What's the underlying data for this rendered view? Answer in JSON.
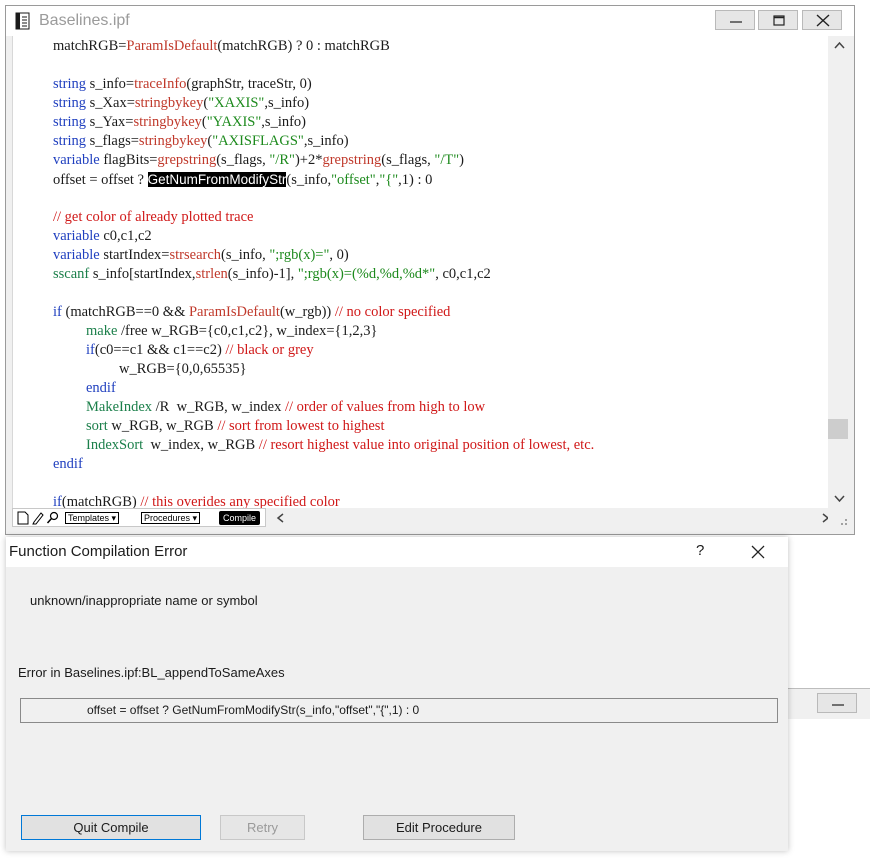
{
  "window": {
    "title": "Baselines.ipf",
    "icons": {
      "doc": "procedure-doc-icon",
      "minimize": "minimize-icon",
      "maximize": "maximize-icon",
      "close": "close-icon"
    }
  },
  "code": {
    "lines": [
      [
        {
          "t": "matchRGB=",
          "c": ""
        },
        {
          "t": "ParamIsDefault",
          "c": "fn"
        },
        {
          "t": "(matchRGB) ? 0 : matchRGB",
          "c": ""
        }
      ],
      [],
      [
        {
          "t": "string",
          "c": "kw"
        },
        {
          "t": " s_info=",
          "c": ""
        },
        {
          "t": "traceInfo",
          "c": "fn"
        },
        {
          "t": "(graphStr, traceStr, 0)",
          "c": ""
        }
      ],
      [
        {
          "t": "string",
          "c": "kw"
        },
        {
          "t": " s_Xax=",
          "c": ""
        },
        {
          "t": "stringbykey",
          "c": "fn"
        },
        {
          "t": "(",
          "c": ""
        },
        {
          "t": "\"XAXIS\"",
          "c": "str"
        },
        {
          "t": ",s_info)",
          "c": ""
        }
      ],
      [
        {
          "t": "string",
          "c": "kw"
        },
        {
          "t": " s_Yax=",
          "c": ""
        },
        {
          "t": "stringbykey",
          "c": "fn"
        },
        {
          "t": "(",
          "c": ""
        },
        {
          "t": "\"YAXIS\"",
          "c": "str"
        },
        {
          "t": ",s_info)",
          "c": ""
        }
      ],
      [
        {
          "t": "string",
          "c": "kw"
        },
        {
          "t": " s_flags=",
          "c": ""
        },
        {
          "t": "stringbykey",
          "c": "fn"
        },
        {
          "t": "(",
          "c": ""
        },
        {
          "t": "\"AXISFLAGS\"",
          "c": "str"
        },
        {
          "t": ",s_info)",
          "c": ""
        }
      ],
      [
        {
          "t": "variable",
          "c": "kw"
        },
        {
          "t": " flagBits=",
          "c": ""
        },
        {
          "t": "grepstring",
          "c": "fn"
        },
        {
          "t": "(s_flags, ",
          "c": ""
        },
        {
          "t": "\"/R\"",
          "c": "str"
        },
        {
          "t": ")+2*",
          "c": ""
        },
        {
          "t": "grepstring",
          "c": "fn"
        },
        {
          "t": "(s_flags, ",
          "c": ""
        },
        {
          "t": "\"/T\"",
          "c": "str"
        },
        {
          "t": ")",
          "c": ""
        }
      ],
      [
        {
          "t": "offset = offset ? ",
          "c": ""
        },
        {
          "t": "GetNumFromModifyStr",
          "c": "sel"
        },
        {
          "t": "(s_info,",
          "c": ""
        },
        {
          "t": "\"offset\"",
          "c": "str"
        },
        {
          "t": ",",
          "c": ""
        },
        {
          "t": "\"{\"",
          "c": "str"
        },
        {
          "t": ",1) : 0",
          "c": ""
        }
      ],
      [],
      [
        {
          "t": "// get color of already plotted trace",
          "c": "cm"
        }
      ],
      [
        {
          "t": "variable",
          "c": "kw"
        },
        {
          "t": " c0,c1,c2",
          "c": ""
        }
      ],
      [
        {
          "t": "variable",
          "c": "kw"
        },
        {
          "t": " startIndex=",
          "c": ""
        },
        {
          "t": "strsearch",
          "c": "fn"
        },
        {
          "t": "(s_info, ",
          "c": ""
        },
        {
          "t": "\";rgb(x)=\"",
          "c": "str"
        },
        {
          "t": ", 0)",
          "c": ""
        }
      ],
      [
        {
          "t": "sscanf",
          "c": "op"
        },
        {
          "t": " s_info[startIndex,",
          "c": ""
        },
        {
          "t": "strlen",
          "c": "fn"
        },
        {
          "t": "(s_info)-1], ",
          "c": ""
        },
        {
          "t": "\";rgb(x)=(%d,%d,%d*\"",
          "c": "str"
        },
        {
          "t": ", c0,c1,c2",
          "c": ""
        }
      ],
      [],
      [
        {
          "t": "if",
          "c": "kw"
        },
        {
          "t": " (matchRGB==0 && ",
          "c": ""
        },
        {
          "t": "ParamIsDefault",
          "c": "fn"
        },
        {
          "t": "(w_rgb)) ",
          "c": ""
        },
        {
          "t": "// no color specified",
          "c": "cm"
        }
      ],
      [
        {
          "t": "\tmake",
          "c": "op"
        },
        {
          "t": " /free w_RGB={c0,c1,c2}, w_index={1,2,3}",
          "c": ""
        }
      ],
      [
        {
          "t": "\tif",
          "c": "kw"
        },
        {
          "t": "(c0==c1 && c1==c2) ",
          "c": ""
        },
        {
          "t": "// black or grey",
          "c": "cm"
        }
      ],
      [
        {
          "t": "\t\tw_RGB={0,0,65535}",
          "c": ""
        }
      ],
      [
        {
          "t": "\tendif",
          "c": "kw"
        }
      ],
      [
        {
          "t": "\tMakeIndex",
          "c": "op"
        },
        {
          "t": " /R  w_RGB, w_index ",
          "c": ""
        },
        {
          "t": "// order of values from high to low",
          "c": "cm"
        }
      ],
      [
        {
          "t": "\tsort",
          "c": "op"
        },
        {
          "t": " w_RGB, w_RGB ",
          "c": ""
        },
        {
          "t": "// sort from lowest to highest",
          "c": "cm"
        }
      ],
      [
        {
          "t": "\tIndexSort",
          "c": "op"
        },
        {
          "t": "  w_index, w_RGB ",
          "c": ""
        },
        {
          "t": "// resort highest value into original position of lowest, etc.",
          "c": "cm"
        }
      ],
      [
        {
          "t": "endif",
          "c": "kw"
        }
      ],
      [],
      [
        {
          "t": "if",
          "c": "kw"
        },
        {
          "t": "(matchRGB) ",
          "c": ""
        },
        {
          "t": "// this overides any specified color",
          "c": "cm"
        }
      ]
    ]
  },
  "toolbar": {
    "templates_label": "Templates",
    "procedures_label": "Procedures",
    "compile_label": "Compile",
    "icons": [
      "page-icon",
      "pencil-icon",
      "magnifier-icon"
    ]
  },
  "dialog": {
    "title": "Function Compilation Error",
    "help": "?",
    "message": "unknown/inappropriate name or symbol",
    "location": "Error in  Baselines.ipf:BL_appendToSameAxes",
    "error_line": "offset = offset ? GetNumFromModifyStr(s_info,\"offset\",\"{\",1) : 0",
    "buttons": {
      "quit": "Quit Compile",
      "retry": "Retry",
      "edit": "Edit Procedure"
    }
  },
  "colors": {
    "keyword": "#1f3fbf",
    "function": "#c0392b",
    "operation": "#1b7f4a",
    "string": "#1d8a1d",
    "comment": "#d01818",
    "focus": "#0078d7"
  }
}
